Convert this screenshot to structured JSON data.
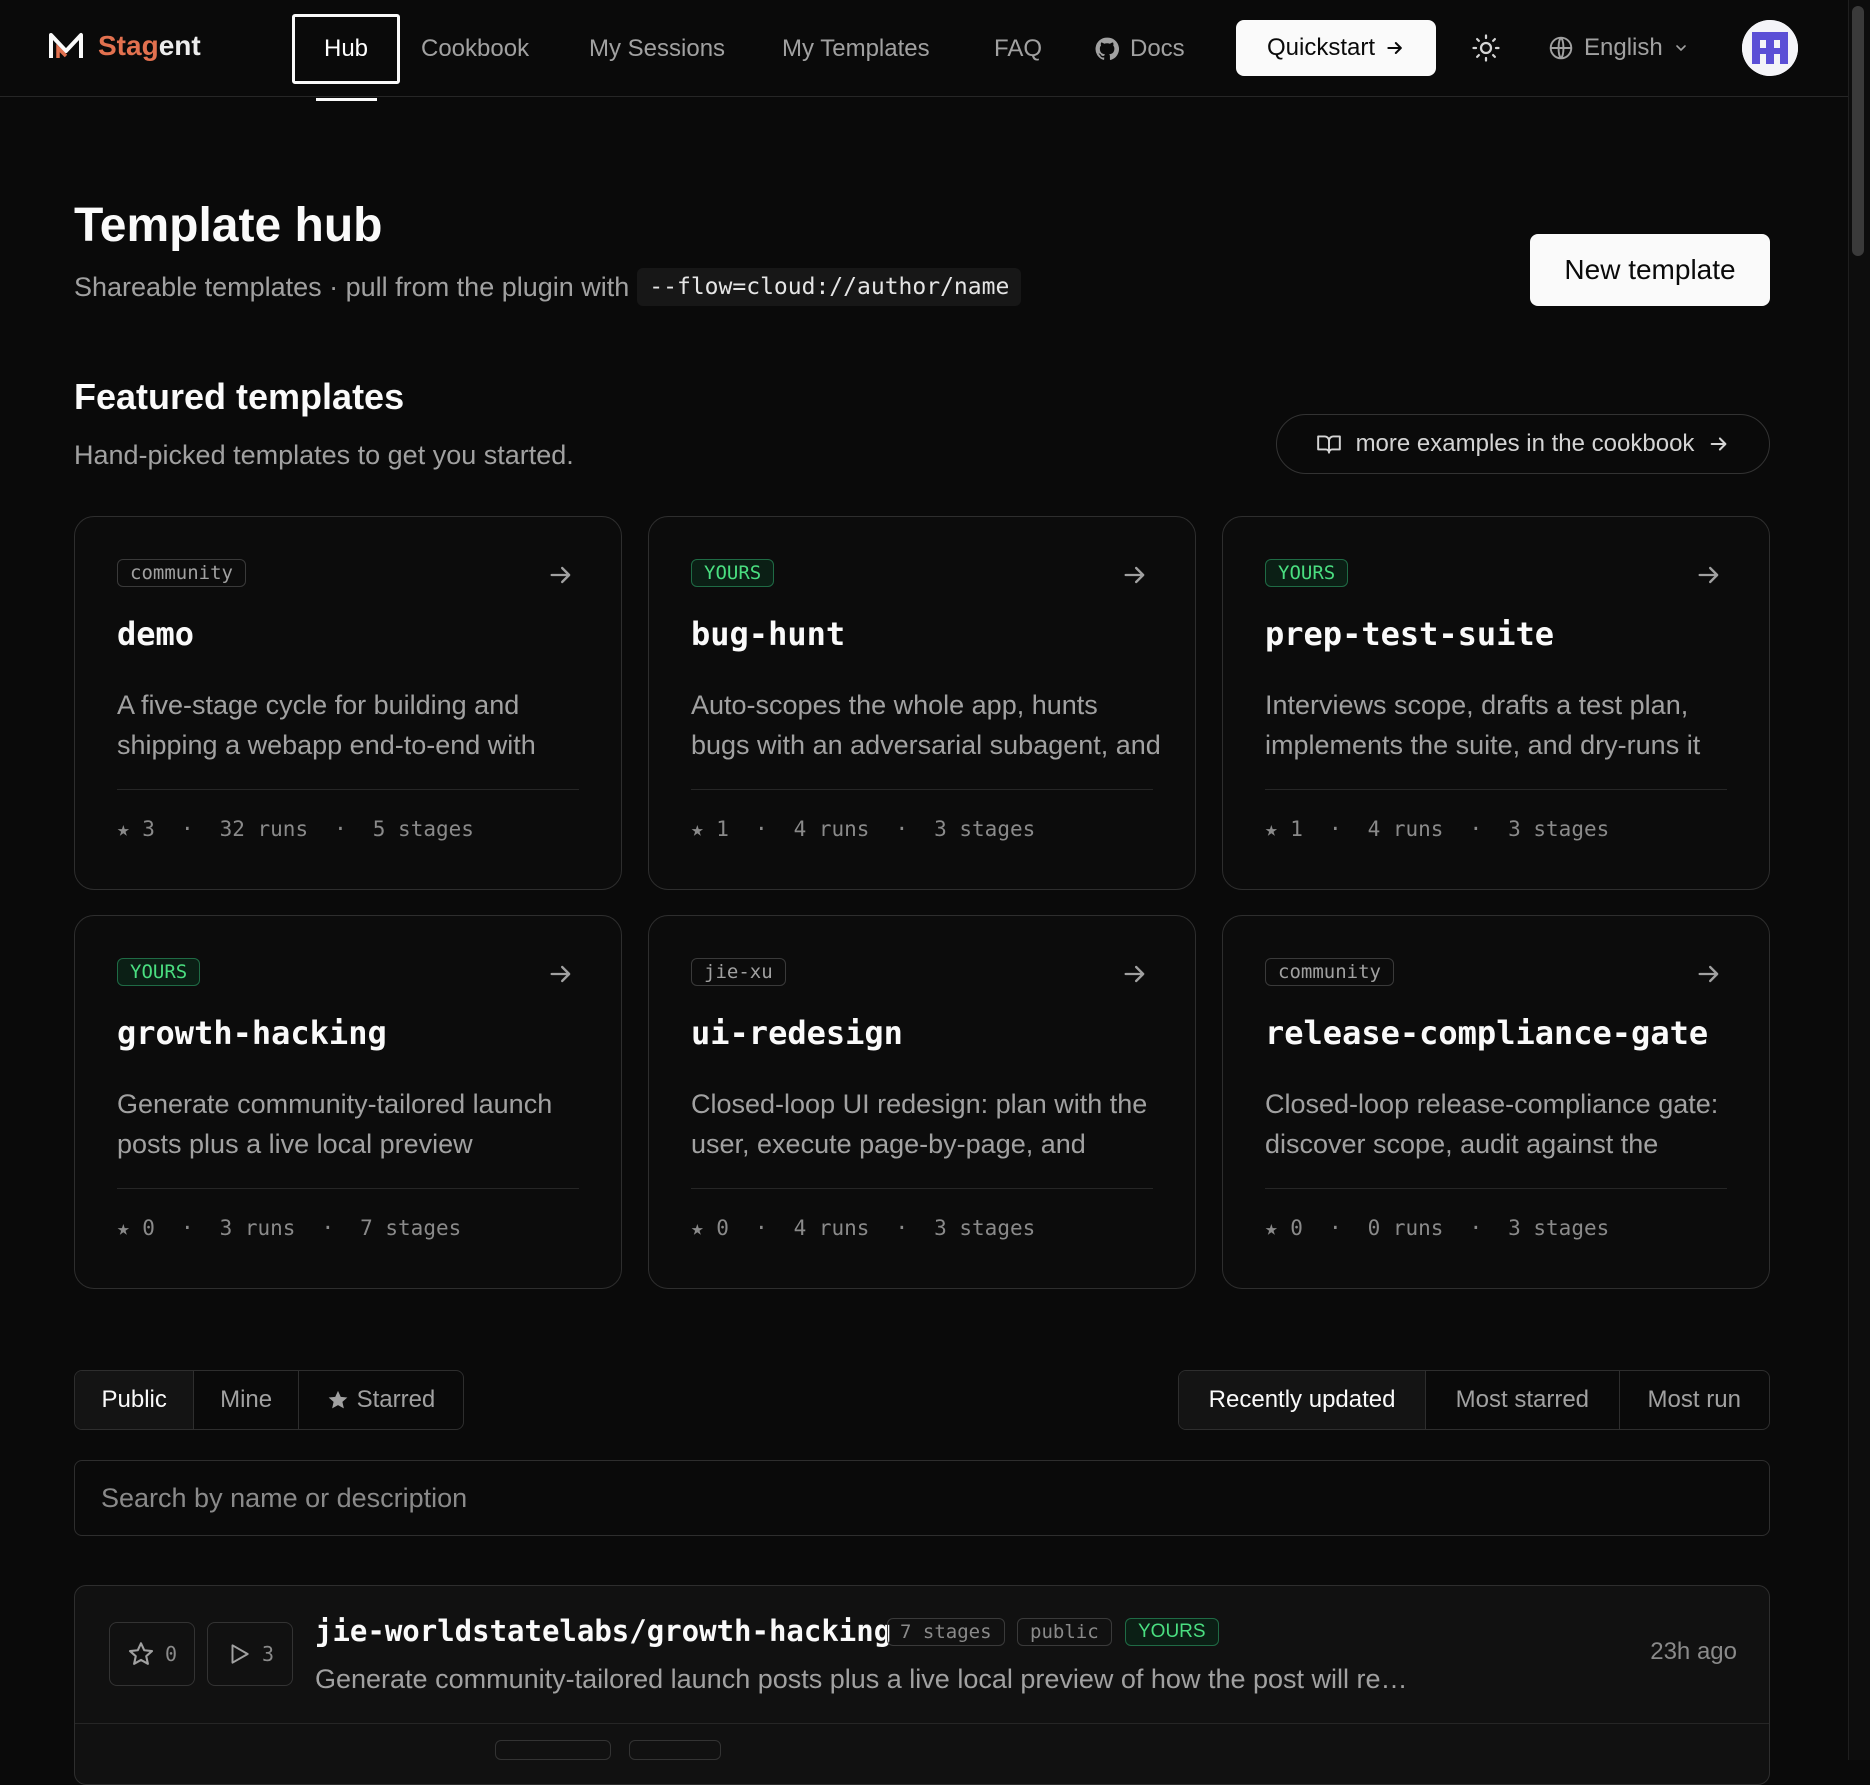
{
  "nav": {
    "brand_a": "Stag",
    "brand_b": "ent",
    "items": [
      "Hub",
      "Cookbook",
      "My Sessions",
      "My Templates",
      "FAQ",
      "Docs"
    ],
    "quickstart": "Quickstart",
    "language": "English"
  },
  "header": {
    "title": "Template hub",
    "subtitle": "Shareable templates · pull from the plugin with",
    "code": "--flow=cloud://author/name",
    "new_template": "New template"
  },
  "featured": {
    "title": "Featured templates",
    "subtitle": "Hand-picked templates to get you started.",
    "cookbook_link": "more examples in the cookbook",
    "cards": [
      {
        "badge": "community",
        "yours": false,
        "name": "demo",
        "desc": "A five-stage cycle for building and shipping a webapp end-to-end with",
        "stars": "★ 3",
        "runs": "32 runs",
        "stages": "5 stages"
      },
      {
        "badge": "YOURS",
        "yours": true,
        "name": "bug-hunt",
        "desc": "Auto-scopes the whole app, hunts bugs with an adversarial subagent, and",
        "stars": "★ 1",
        "runs": "4 runs",
        "stages": "3 stages"
      },
      {
        "badge": "YOURS",
        "yours": true,
        "name": "prep-test-suite",
        "desc": "Interviews scope, drafts a test plan, implements the suite, and dry-runs it",
        "stars": "★ 1",
        "runs": "4 runs",
        "stages": "3 stages"
      },
      {
        "badge": "YOURS",
        "yours": true,
        "name": "growth-hacking",
        "desc": "Generate community-tailored launch posts plus a live local preview",
        "stars": "★ 0",
        "runs": "3 runs",
        "stages": "7 stages"
      },
      {
        "badge": "jie-xu",
        "yours": false,
        "name": "ui-redesign",
        "desc": "Closed-loop UI redesign: plan with the user, execute page-by-page, and",
        "stars": "★ 0",
        "runs": "4 runs",
        "stages": "3 stages"
      },
      {
        "badge": "community",
        "yours": false,
        "name": "release-compliance-gate",
        "desc": "Closed-loop release-compliance gate: discover scope, audit against the",
        "stars": "★ 0",
        "runs": "0 runs",
        "stages": "3 stages"
      }
    ]
  },
  "filters": {
    "scope": [
      "Public",
      "Mine",
      "Starred"
    ],
    "sort": [
      "Recently updated",
      "Most starred",
      "Most run"
    ]
  },
  "search": {
    "placeholder": "Search by name or description"
  },
  "list": [
    {
      "stars": "0",
      "runs": "3",
      "name": "jie-worldstatelabs/growth-hacking",
      "stages": "7 stages",
      "visibility": "public",
      "badge": "YOURS",
      "desc": "Generate community-tailored launch posts plus a live local preview of how the post will render — and more",
      "ago": "23h ago"
    }
  ],
  "colors": {
    "background": "#0a0a0a",
    "brand_accent": "#e2714f",
    "yours_badge": "#4ade80"
  }
}
